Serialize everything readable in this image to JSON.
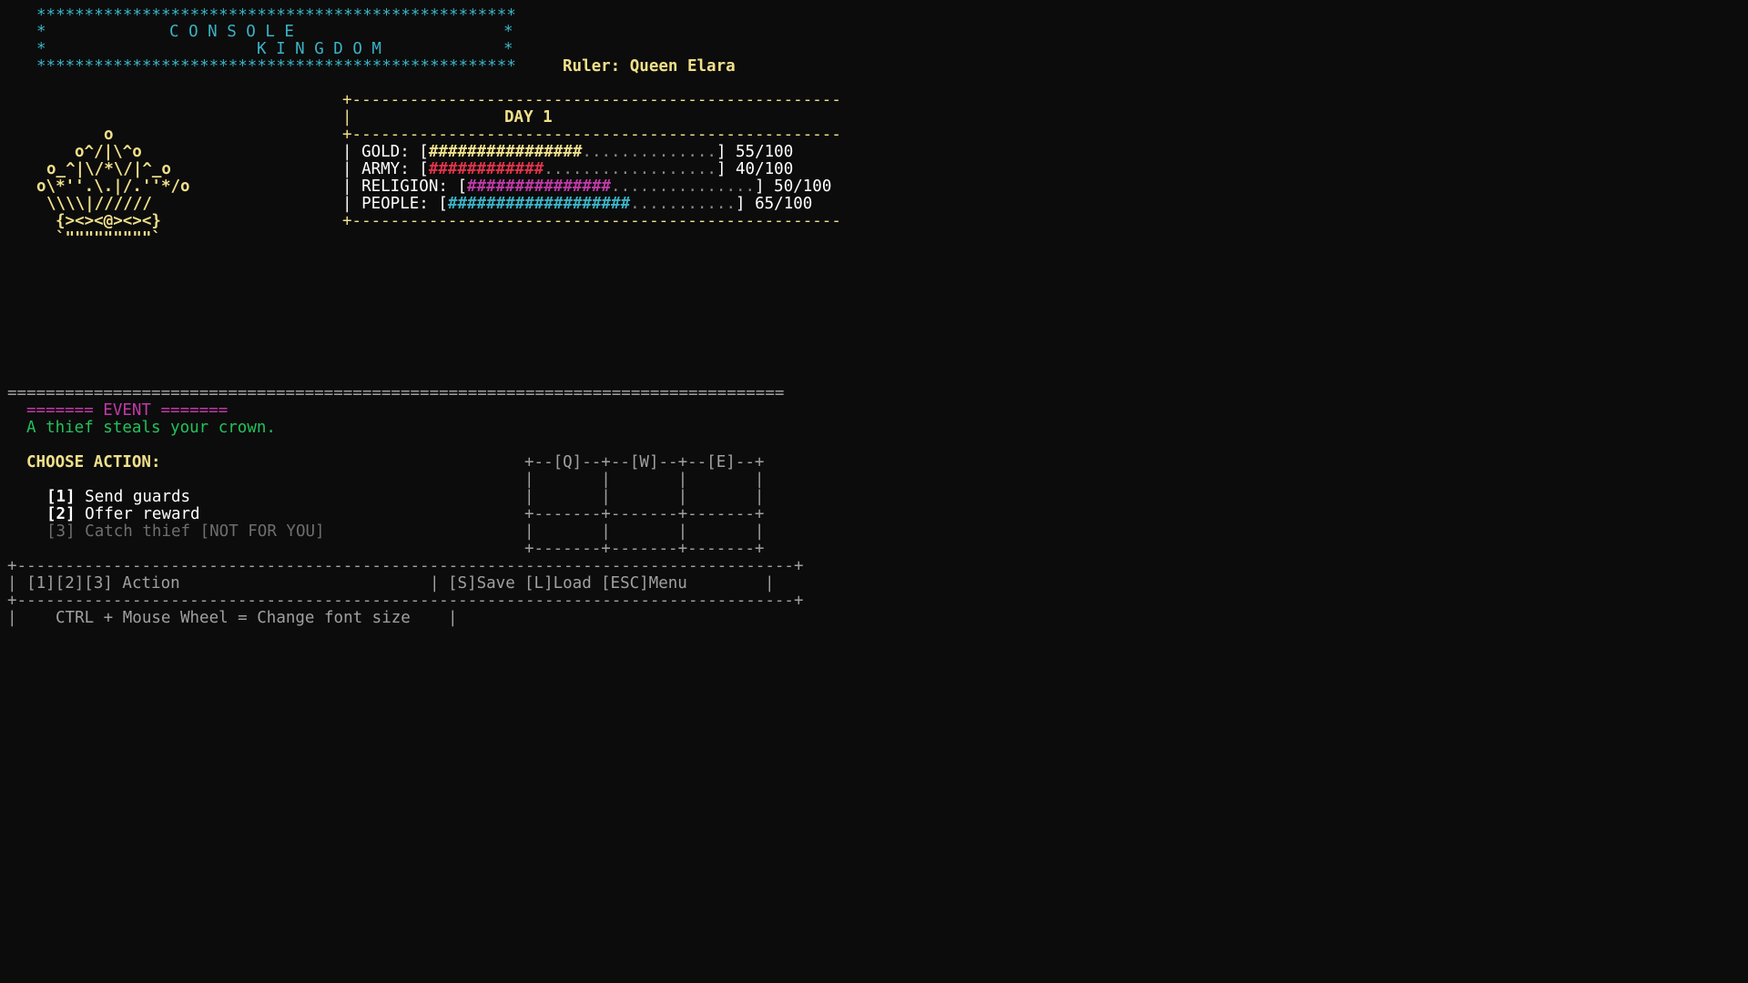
{
  "banner": {
    "border": "**************************************************",
    "line1_left": "*",
    "title1": "C O N S O L E",
    "line1_right": "*",
    "line2_left": "*",
    "title2": "K I N G D O M",
    "line2_right": "*",
    "ruler": "Ruler: Queen Elara"
  },
  "crown_art": [
    "o",
    "o^/|\\^o",
    "o_^|\\/*\\/|^_o",
    "o\\*''.\\.|/.''*/o",
    "\\\\\\\\|//////",
    "{><><@><><}",
    "`\"\"\"\"\"\"\"\"\"`"
  ],
  "stats": {
    "border": "+---------------------------------------------------",
    "day_label": "DAY 1",
    "bars": [
      {
        "label": "GOLD:",
        "filled": "################",
        "empty": "..............",
        "value": "55/100",
        "level": 0.55,
        "color": "#f0e08a"
      },
      {
        "label": "ARMY:",
        "filled": "############",
        "empty": "..................",
        "value": "40/100",
        "level": 0.4,
        "color": "#e0344a"
      },
      {
        "label": "RELIGION:",
        "filled": "###############",
        "empty": "...............",
        "value": "50/100",
        "level": 0.5,
        "color": "#c03aa8"
      },
      {
        "label": "PEOPLE:",
        "filled": "###################",
        "empty": "...........",
        "value": "65/100",
        "level": 0.65,
        "color": "#3ab3c6"
      }
    ]
  },
  "divider": "=================================================================================",
  "event": {
    "header": "======= EVENT =======",
    "text": "A thief steals your crown."
  },
  "choose_label": "CHOOSE ACTION:",
  "actions": [
    {
      "key": "[1]",
      "label": "Send guards"
    },
    {
      "key": "[2]",
      "label": "Offer reward"
    },
    {
      "key": "[3]",
      "label": "Catch thief [NOT FOR YOU]"
    }
  ],
  "grid": [
    "+--[Q]--+--[W]--+--[E]--+",
    "|       |       |       |",
    "|       |       |       |",
    "+-------+-------+-------+",
    "|       |       |       |",
    "+-------+-------+-------+"
  ],
  "footer": {
    "border": "+---------------------------------------------------------------------------------+",
    "left": "| [1][2][3] Action",
    "sep": "|",
    "save": "[S]Save",
    "load": "[L]Load",
    "menu": "[ESC]Menu",
    "end": "|",
    "hint_left": "|",
    "hint": "CTRL + Mouse Wheel = Change font size",
    "hint_right": "|"
  }
}
